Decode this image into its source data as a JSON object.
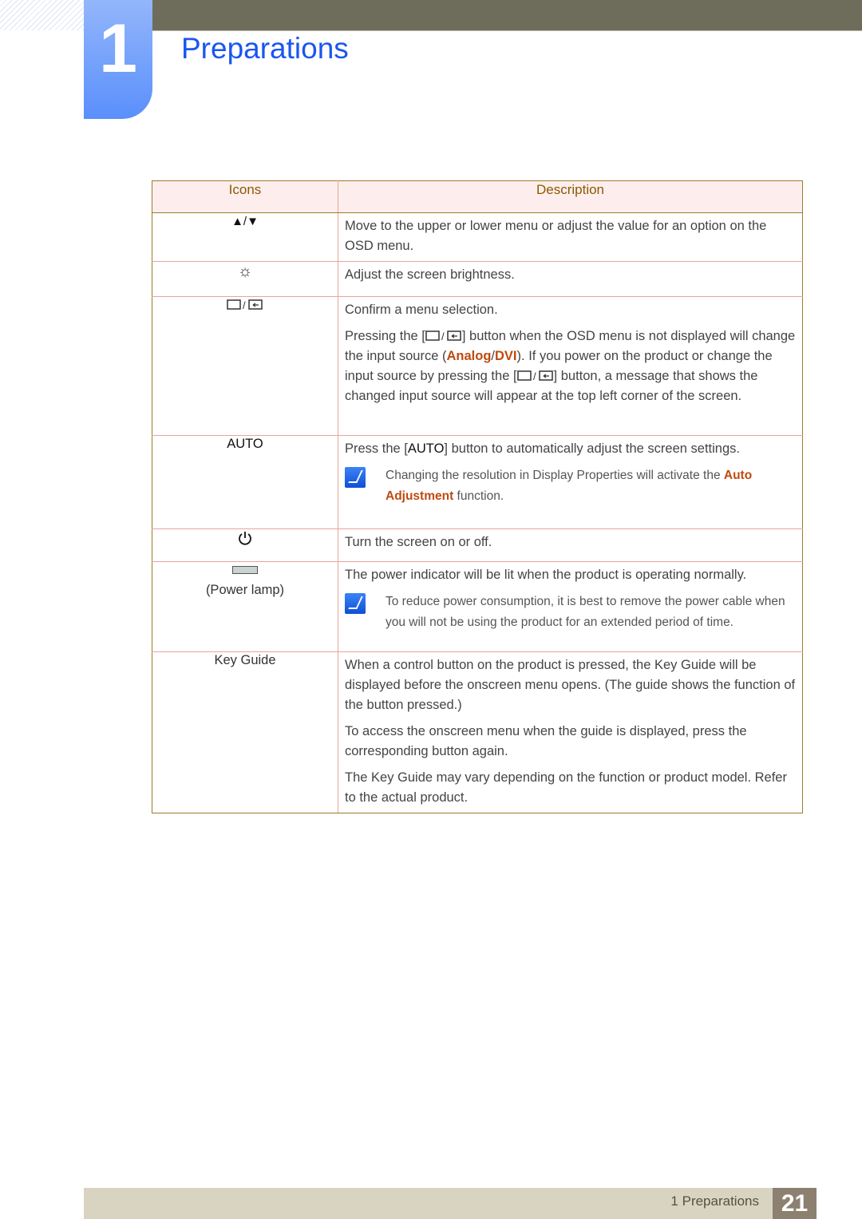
{
  "header": {
    "chapter_number": "1",
    "title": "Preparations"
  },
  "table": {
    "columns": [
      "Icons",
      "Description"
    ],
    "rows": {
      "updown": {
        "icon": "up-down-triangle-icons",
        "desc": "Move to the upper or lower menu or adjust the value for an option on the OSD menu."
      },
      "brightness": {
        "icon": "brightness-sun-icon",
        "desc": "Adjust the screen brightness."
      },
      "source": {
        "icon": "source-enter-icons",
        "p1": "Confirm a menu selection.",
        "p2_a": "Pressing the [",
        "p2_b": "] button when the OSD menu is not displayed will change the input source (",
        "p2_analog": "Analog",
        "p2_slash": "/",
        "p2_dvi": "DVI",
        "p2_c": "). If you power on the product or change the input source by pressing the [",
        "p2_d": "] button, a message that shows the changed input source will appear at the top left corner of the screen."
      },
      "auto": {
        "label": "AUTO",
        "p1_a": "Press the [",
        "p1_key": "AUTO",
        "p1_b": "] button to automatically adjust the screen settings.",
        "note_a": "Changing the resolution in Display Properties will activate the ",
        "note_hl": "Auto Adjustment",
        "note_b": " function."
      },
      "power": {
        "icon": "power-icon",
        "desc": "Turn the screen on or off."
      },
      "lamp": {
        "label": "(Power lamp)",
        "p1": "The power indicator will be lit when the product is operating normally.",
        "note": "To reduce power consumption, it is best to remove the power cable when you will not be using the product for an extended period of time."
      },
      "keyguide": {
        "label": "Key Guide",
        "p1": "When a control button on the product is pressed, the Key Guide will be displayed before the onscreen menu opens. (The guide shows the function of the button pressed.)",
        "p2": "To access the onscreen menu when the guide is displayed, press the corresponding button again.",
        "p3": "The Key Guide may vary depending on the function or product model. Refer to the actual product."
      }
    }
  },
  "footer": {
    "section": "1 Preparations",
    "page": "21"
  },
  "colors": {
    "title_blue": "#1a56f0",
    "highlight": "#c04a10",
    "header_text": "#8b5a00"
  }
}
